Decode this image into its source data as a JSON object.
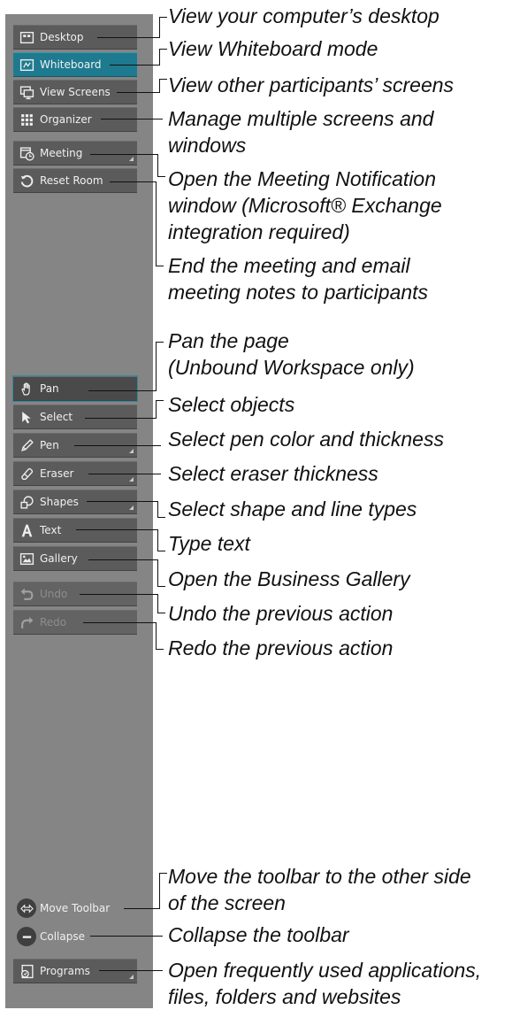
{
  "toolbar": {
    "items": {
      "desktop": "Desktop",
      "whiteboard": "Whiteboard",
      "view_screens": "View Screens",
      "organizer": "Organizer",
      "meeting": "Meeting",
      "reset_room": "Reset Room",
      "pan": "Pan",
      "select": "Select",
      "pen": "Pen",
      "eraser": "Eraser",
      "shapes": "Shapes",
      "text": "Text",
      "gallery": "Gallery",
      "undo": "Undo",
      "redo": "Redo",
      "move_toolbar": "Move Toolbar",
      "collapse": "Collapse",
      "programs": "Programs"
    },
    "active_item": "Whiteboard",
    "accent_color": "#1e7a8f"
  },
  "callouts": {
    "desktop": [
      "View your computer’s desktop"
    ],
    "whiteboard": [
      "View Whiteboard mode"
    ],
    "view_screens": [
      "View other participants’ screens"
    ],
    "organizer": [
      "Manage multiple screens and",
      "windows"
    ],
    "meeting": [
      "Open the Meeting Notification",
      "window (Microsoft® Exchange",
      "integration required)"
    ],
    "reset_room": [
      "End the meeting and email",
      "meeting notes to participants"
    ],
    "pan": [
      "Pan the page",
      "(Unbound Workspace only)"
    ],
    "select": [
      "Select objects"
    ],
    "pen": [
      "Select pen color and thickness"
    ],
    "eraser": [
      "Select eraser thickness"
    ],
    "shapes": [
      "Select shape and line types"
    ],
    "text": [
      "Type text"
    ],
    "gallery": [
      "Open the Business Gallery"
    ],
    "undo": [
      "Undo the previous action"
    ],
    "redo": [
      "Redo the previous action"
    ],
    "move_toolbar": [
      "Move the toolbar to the other side",
      "of the screen"
    ],
    "collapse": [
      "Collapse the toolbar"
    ],
    "programs": [
      "Open frequently used applications,",
      "files, folders and websites"
    ]
  }
}
